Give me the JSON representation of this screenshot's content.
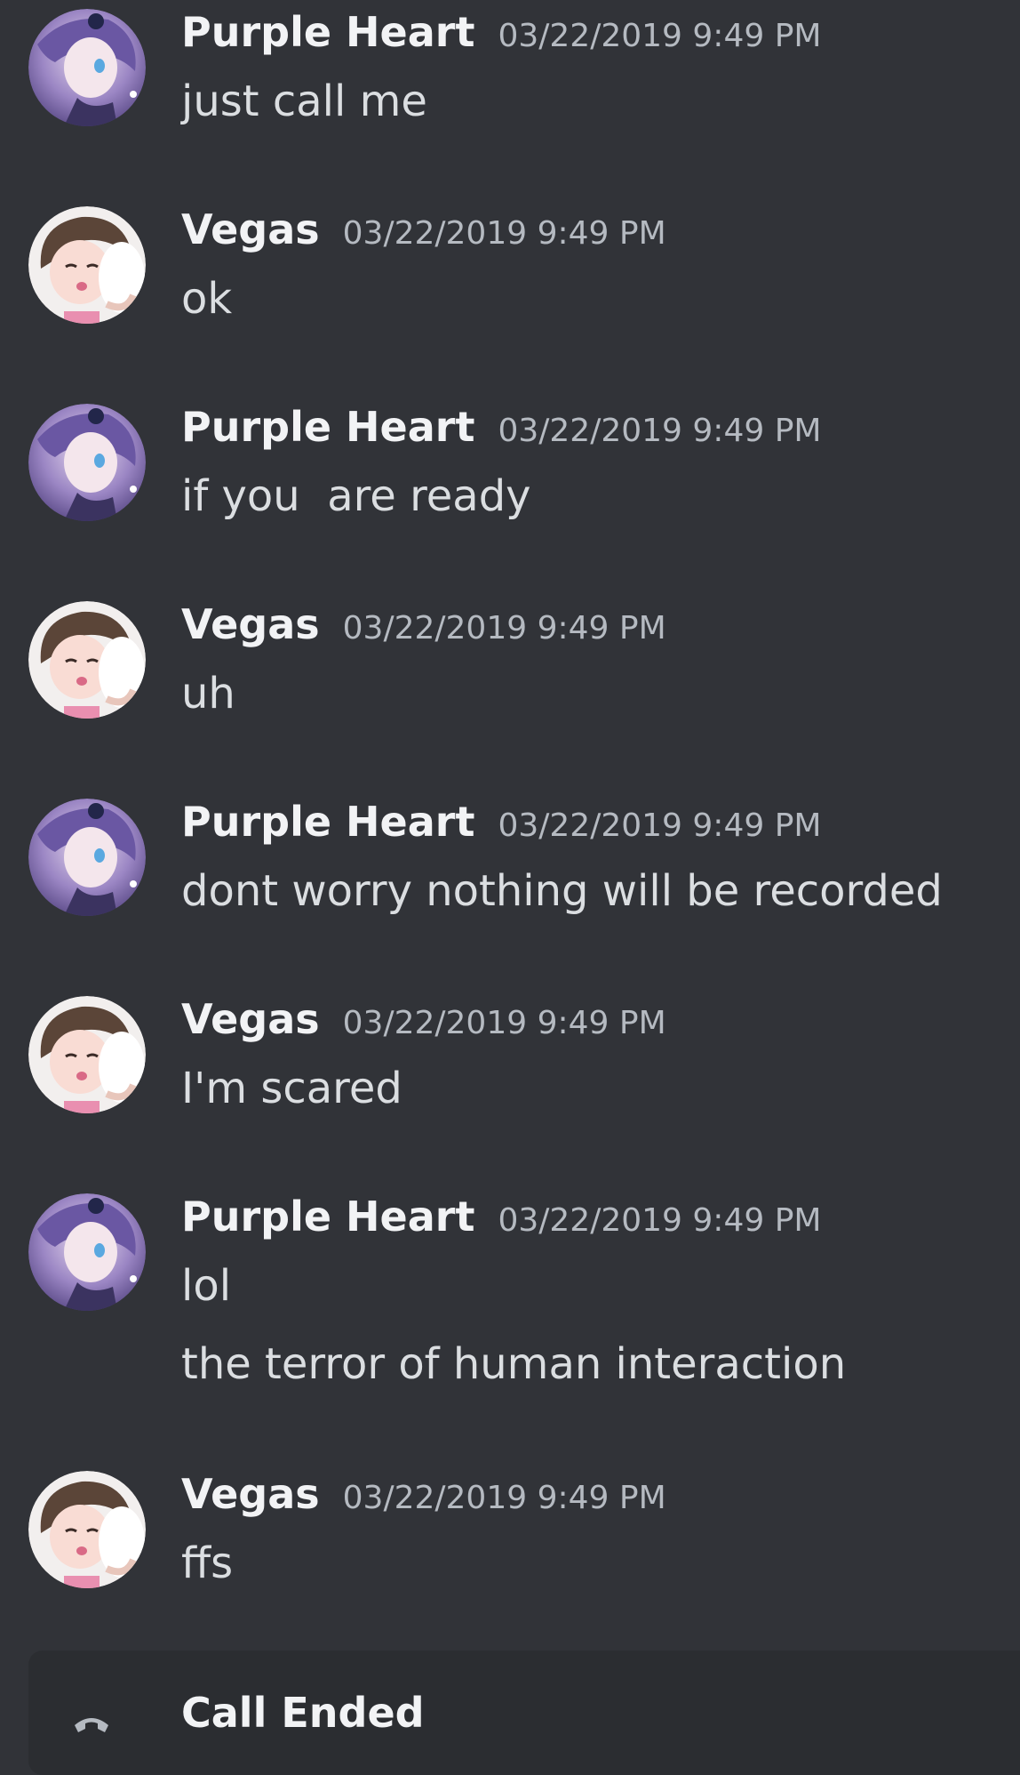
{
  "messages": [
    {
      "author": "Purple Heart",
      "timestamp": "03/22/2019 9:49 PM",
      "lines": [
        "just call me"
      ],
      "avatar": "purple-heart-avatar"
    },
    {
      "author": "Vegas",
      "timestamp": "03/22/2019 9:49 PM",
      "lines": [
        "ok"
      ],
      "avatar": "vegas-avatar"
    },
    {
      "author": "Purple Heart",
      "timestamp": "03/22/2019 9:49 PM",
      "lines": [
        "if you  are ready"
      ],
      "avatar": "purple-heart-avatar"
    },
    {
      "author": "Vegas",
      "timestamp": "03/22/2019 9:49 PM",
      "lines": [
        "uh"
      ],
      "avatar": "vegas-avatar"
    },
    {
      "author": "Purple Heart",
      "timestamp": "03/22/2019 9:49 PM",
      "lines": [
        "dont worry nothing will be recorded"
      ],
      "avatar": "purple-heart-avatar"
    },
    {
      "author": "Vegas",
      "timestamp": "03/22/2019 9:49 PM",
      "lines": [
        "I'm scared"
      ],
      "avatar": "vegas-avatar"
    },
    {
      "author": "Purple Heart",
      "timestamp": "03/22/2019 9:49 PM",
      "lines": [
        "lol",
        "the terror of human interaction"
      ],
      "avatar": "purple-heart-avatar"
    },
    {
      "author": "Vegas",
      "timestamp": "03/22/2019 9:49 PM",
      "lines": [
        "ffs"
      ],
      "avatar": "vegas-avatar"
    }
  ],
  "call": {
    "title": "Call Ended",
    "icon": "phone-icon"
  },
  "colors": {
    "background": "#313338",
    "card": "#2b2d31",
    "author": "#f2f3f5",
    "timestamp": "#b5bac1",
    "text": "#dbdee1"
  }
}
